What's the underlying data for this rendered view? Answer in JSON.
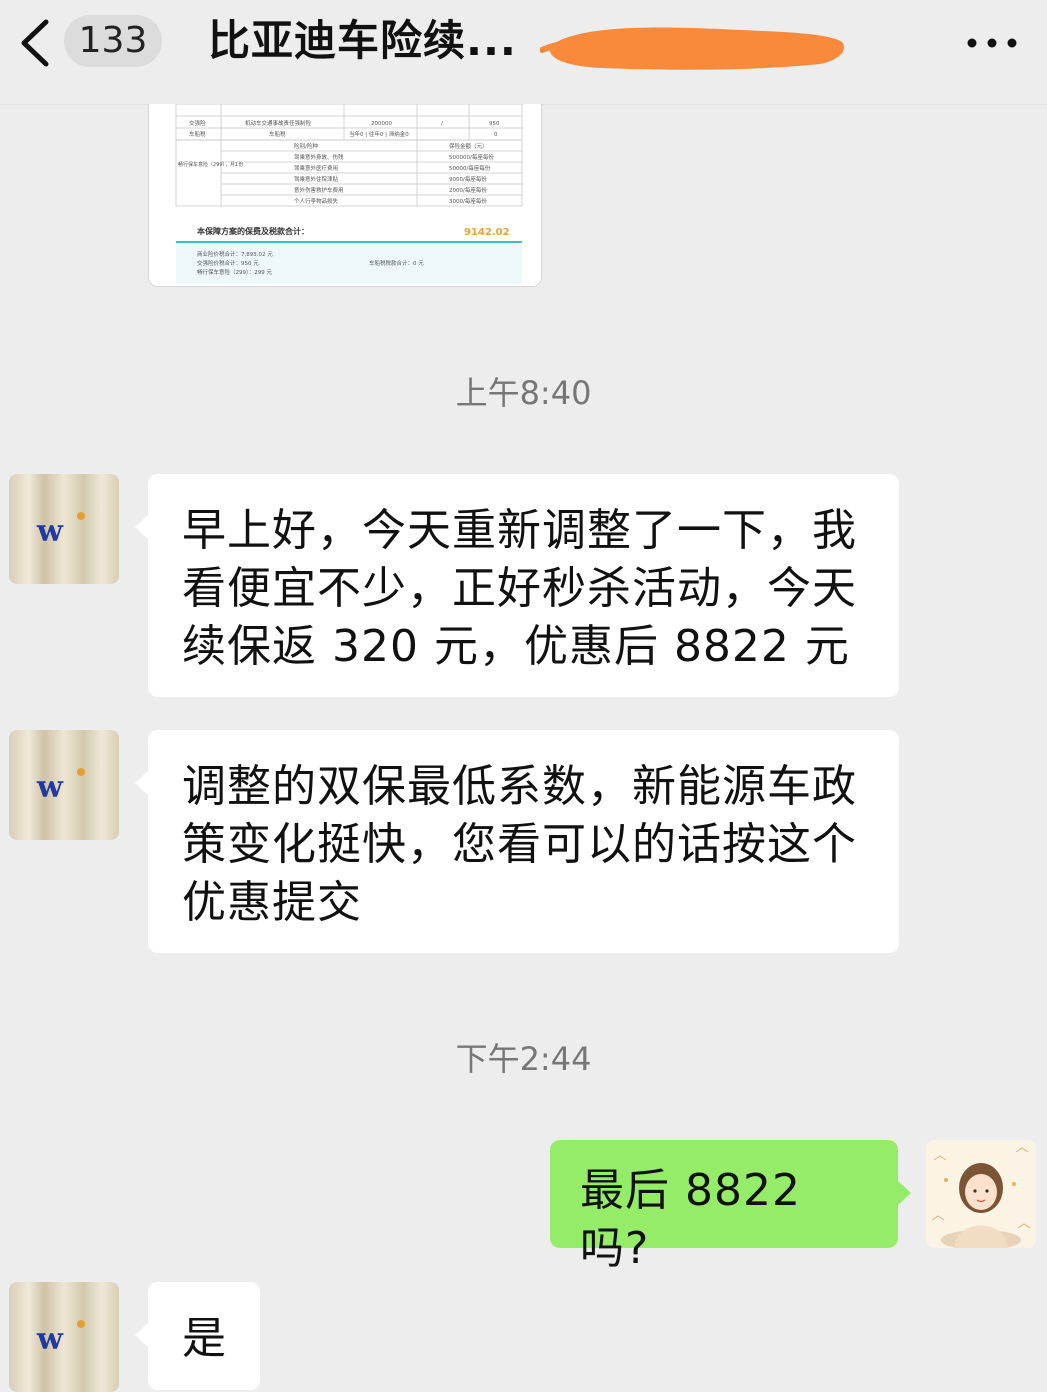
{
  "header": {
    "unread_count": "133",
    "title": "比亚迪车险续..."
  },
  "image_message": {
    "total_label": "本保障方案的保费及税款合计：",
    "total_value": "9142.02",
    "rows": [
      {
        "col1": "交强险",
        "col2": "机动车交通事故责任强制险",
        "col3": "200000",
        "col4": "/",
        "col5": "950"
      },
      {
        "col1": "车船税",
        "col2": "车船税",
        "col3": "当年0 | 往年0 | 滞纳金0",
        "col4": "",
        "col5": "0"
      }
    ],
    "subtable_label": "畅行保车意险（299），月1份",
    "subrows": [
      {
        "name": "险别/险种",
        "amount": "保险金额（元）"
      },
      {
        "name": "驾乘意外身故、伤残",
        "amount": "500000/每座每份"
      },
      {
        "name": "驾乘意外医疗费用",
        "amount": "50000/每座每份"
      },
      {
        "name": "驾乘意外住院津贴",
        "amount": "9000/每座每份"
      },
      {
        "name": "意外伤害救护车费用",
        "amount": "2000/每座每份"
      },
      {
        "name": "个人行李物品损失",
        "amount": "3000/每座每份"
      }
    ],
    "footer": [
      "商业险价税合计：7,893.02 元",
      "交强险价税合计：950 元",
      "畅行保车意险（299）：299 元",
      "车船税税款合计：0 元"
    ]
  },
  "timestamps": [
    "上午8:40",
    "下午2:44"
  ],
  "messages": [
    {
      "side": "left",
      "lines": [
        "早上好，今天重新调整了一下，我",
        "看便宜不少，正好秒杀活动，今天",
        "续保返 320 元，优惠后 8822 元"
      ]
    },
    {
      "side": "left",
      "lines": [
        "调整的双保最低系数，新能源车政",
        "策变化挺快，您看可以的话按这个",
        "优惠提交"
      ]
    },
    {
      "side": "right",
      "lines": [
        "最后 8822 吗?"
      ]
    },
    {
      "side": "left",
      "lines": [
        "是"
      ]
    }
  ],
  "avatar_text": "w",
  "colors": {
    "background": "#ededed",
    "bubble_left": "#ffffff",
    "bubble_right": "#95ec69",
    "redaction": "#f98a3c",
    "total_value": "#f0a030",
    "avatar_logo": "#1f3aa0"
  }
}
